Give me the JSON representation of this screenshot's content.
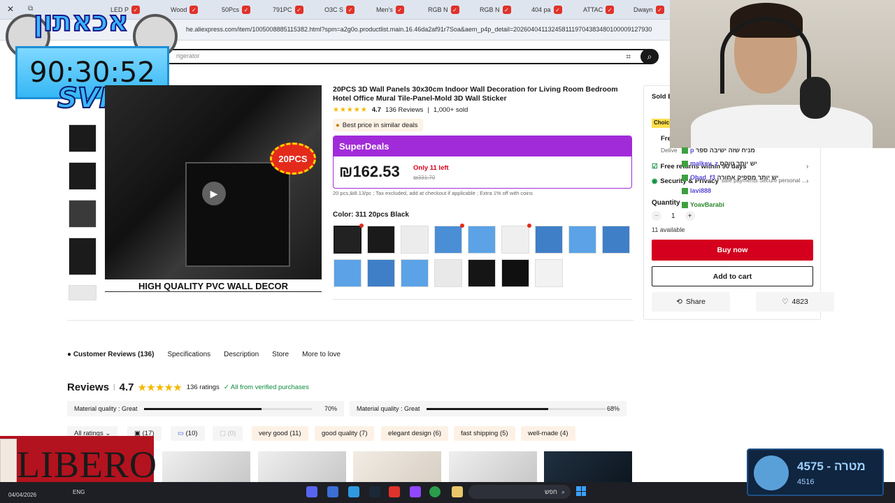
{
  "browser": {
    "tabs": [
      "LED P",
      "Wood",
      "50Pcs",
      "791PC",
      "O3C S",
      "Men's",
      "RGB N",
      "RGB N",
      "404 pa",
      "ATTAC",
      "Dwayn"
    ],
    "url": "he.aliexpress.com/item/1005008885115382.html?spm=a2g0o.productlist.main.16.46da2af91r7Soa&aem_p4p_detail=2026040411324581119704383480100009127930",
    "search_placeholder": "rigerator"
  },
  "overlay": {
    "hebrew_title": "אכאתון",
    "timer": "90:30:52",
    "tag": "SVR"
  },
  "product": {
    "title": "20PCS 3D Wall Panels 30x30cm Indoor Wall Decoration for Living Room Bedroom Hotel Office Mural Tile-Panel-Mold 3D Wall Sticker",
    "rating": "4.7",
    "reviews": "136 Reviews",
    "sold": "1,000+ sold",
    "best_price": "Best price in similar deals",
    "superdeals": "SuperDeals",
    "price": "₪162.53",
    "only_left": "Only 11 left",
    "old_price": "₪331.70",
    "tax_note": "20 pcs,₪8.13/pc ; Tax excluded, add at checkout if applicable ; Extra 1% off with coins",
    "color_label": "Color: 311 20pcs Black",
    "image_badge": "20PCS",
    "image_caption": "HIGH QUALITY PVC WALL DECOR"
  },
  "purchase": {
    "sold_by": "Sold B",
    "choice": "Choic",
    "free_ship": "Free",
    "deliver": "Delive",
    "free_returns": "Free returns within 90 days",
    "security": "Security & Privacy",
    "security_sub": "safe payments Secure personal ...",
    "quantity_label": "Quantity",
    "quantity": "1",
    "minus": "−",
    "plus": "+",
    "available": "11 available",
    "buy_now": "Buy now",
    "add_to_cart": "Add to cart",
    "share": "Share",
    "wishlist": "4823"
  },
  "chat": [
    {
      "user": "p",
      "text": "מניח שזה ישיבה ספר"
    },
    {
      "user": "malkey_z",
      "text": "יש יותר טוקס"
    },
    {
      "user": "Ohad_f3",
      "text": "יש יותר מספיק אחורה"
    },
    {
      "user": "lavi888",
      "text": ""
    },
    {
      "user": "YoavBarabi",
      "text": ""
    }
  ],
  "nav_tabs": [
    "Customer Reviews (136)",
    "Specifications",
    "Description",
    "Store",
    "More to love"
  ],
  "reviews": {
    "title": "Reviews",
    "score": "4.7",
    "count": "136 ratings",
    "verified": "All from verified purchases",
    "metrics": [
      {
        "label": "Material quality : Great",
        "pct": "70%",
        "value": 0.7
      },
      {
        "label": "Material quality : Great",
        "pct": "68%",
        "value": 0.68
      }
    ],
    "filters": [
      "All ratings",
      "(17)",
      "(10)",
      "(0)",
      "very good (11)",
      "good quality (7)",
      "elegant design (6)",
      "fast shipping (5)",
      "well-made (4)"
    ]
  },
  "ad": {
    "brand": "LIBERO"
  },
  "taskbar": {
    "date": "04/04/2026",
    "lang": "ENG",
    "search": "חפש"
  },
  "goal": {
    "value": "4575 - מטרה",
    "sub": "4516"
  },
  "colors": {
    "accent": "#d4001e",
    "superdeals": "#a12bd9",
    "stars": "#f5b800",
    "verified": "#0a8a3a"
  }
}
